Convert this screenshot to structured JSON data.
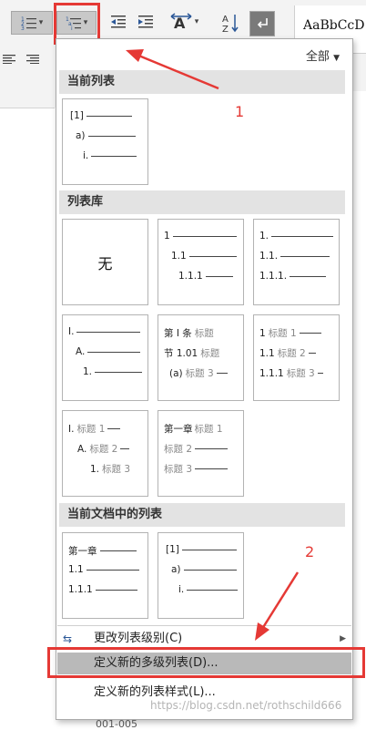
{
  "ribbon": {
    "styles_sample": "AaBbCcD"
  },
  "panel": {
    "filter_label": "全部",
    "sections": {
      "current": "当前列表",
      "library": "列表库",
      "in_document": "当前文档中的列表"
    },
    "current_tile": {
      "lines": [
        "[1]",
        "a)",
        "i."
      ]
    },
    "library_tiles": [
      {
        "none_label": "无"
      },
      {
        "lines": [
          "1",
          "1.1",
          "1.1.1"
        ]
      },
      {
        "lines": [
          "1.",
          "1.1.",
          "1.1.1."
        ]
      },
      {
        "lines": [
          "I.",
          "A.",
          "1."
        ]
      },
      {
        "lines": [
          "第 I 条",
          "节 1.01",
          "(a)"
        ],
        "tags": [
          "标题",
          "标题",
          "标题 3"
        ]
      },
      {
        "lines": [
          "1",
          "1.1",
          "1.1.1"
        ],
        "tags": [
          "标题 1",
          "标题 2",
          "标题 3"
        ]
      },
      {
        "lines": [
          "I.",
          "A.",
          "1."
        ],
        "tags": [
          "标题 1",
          "标题 2",
          "标题 3"
        ]
      },
      {
        "lines": [
          "第一章",
          "",
          ""
        ],
        "tags": [
          "标题 1",
          "标题 2",
          "标题 3"
        ]
      }
    ],
    "doc_tiles": [
      {
        "lines": [
          "第一章",
          "1.1",
          "1.1.1"
        ]
      },
      {
        "lines": [
          "[1]",
          "a)",
          "i."
        ]
      }
    ],
    "menu": {
      "change_level": "更改列表级别(C)",
      "define_multilevel": "定义新的多级列表(D)...",
      "define_style": "定义新的列表样式(L)..."
    }
  },
  "annotations": {
    "step1": "1",
    "step2": "2",
    "watermark": "https://blog.csdn.net/rothschild666",
    "bottom_text": "001-005"
  },
  "colors": {
    "annotation": "#e53935",
    "hover_row": "#b9b9b9",
    "section_header": "#e3e3e3"
  }
}
